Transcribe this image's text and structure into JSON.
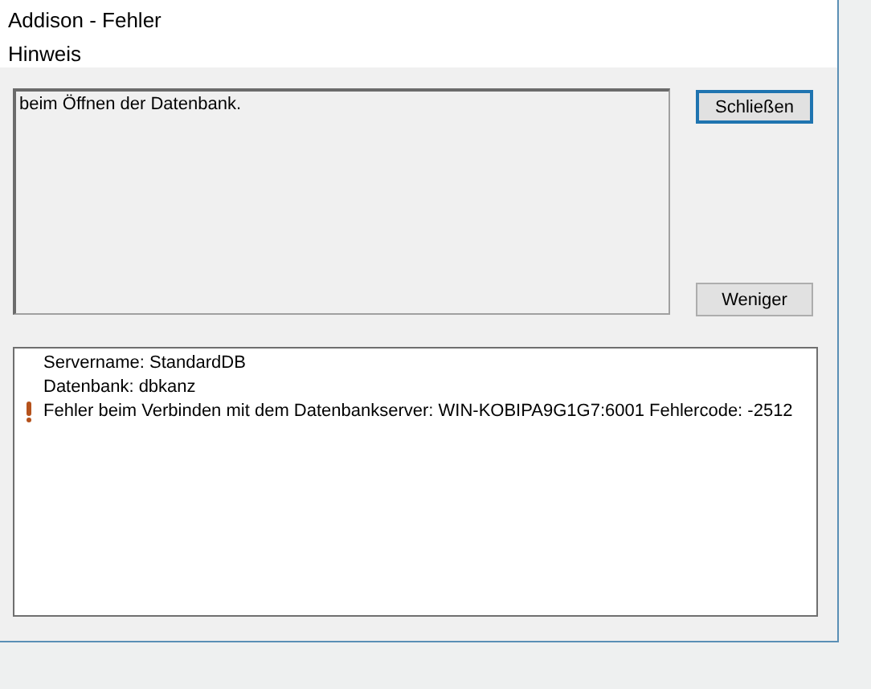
{
  "window": {
    "title": "Addison - Fehler"
  },
  "header": "Hinweis",
  "message": "beim Öffnen der Datenbank.",
  "buttons": [
    {
      "label": "Schließen",
      "default": true
    },
    {
      "label": "Weniger",
      "default": false
    }
  ],
  "details": [
    {
      "kind": "info",
      "text": "Servername: StandardDB"
    },
    {
      "kind": "info",
      "text": "Datenbank: dbkanz"
    },
    {
      "kind": "error",
      "text": "Fehler beim Verbinden mit dem Datenbankserver: WIN-KOBIPA9G1G7:6001 Fehlercode: -2512"
    }
  ]
}
